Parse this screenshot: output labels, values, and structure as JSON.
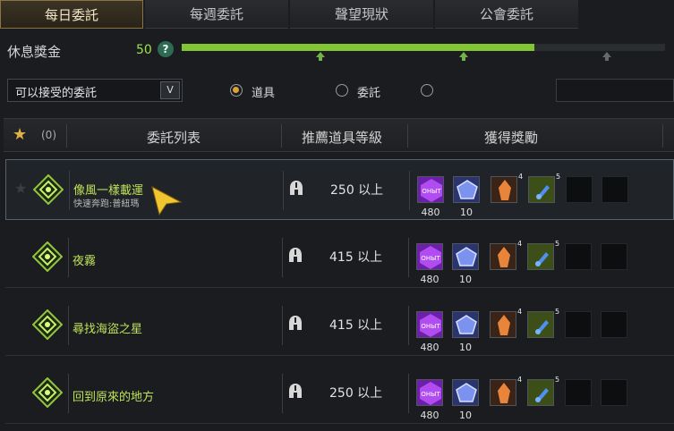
{
  "tabs": [
    {
      "label": "每日委託",
      "active": true
    },
    {
      "label": "每週委託",
      "active": false
    },
    {
      "label": "聲望現狀",
      "active": false
    },
    {
      "label": "公會委託",
      "active": false
    }
  ],
  "rest_bonus": {
    "label": "休息獎金",
    "value": "50",
    "help": "?",
    "fill_fraction": 0.73
  },
  "filter": {
    "select_value": "可以接受的委託",
    "select_arrow": "V",
    "radio_options": [
      {
        "label": "道具",
        "checked": true
      },
      {
        "label": "委託",
        "checked": false
      },
      {
        "label": "",
        "checked": false
      }
    ]
  },
  "table_header": {
    "favorite_count": "(0)",
    "col_list": "委託列表",
    "col_level": "推薦道具等級",
    "col_rewards": "獲得獎勵"
  },
  "rewards": [
    {
      "qty": "480",
      "icon": "purple-crystal-icon",
      "color": "#8b2fc9",
      "text": "ОНЫТ"
    },
    {
      "qty": "10",
      "icon": "blue-gem-icon",
      "color": "#4a63c6"
    },
    {
      "qty": "",
      "icon": "amber-crystal-icon",
      "color": "#c8742b",
      "sup": "4"
    },
    {
      "qty": "",
      "icon": "blue-potion-icon",
      "color": "#5f7a1f",
      "sup": "5"
    }
  ],
  "quests": [
    {
      "name": "像風一樣載運",
      "sub": "快速奔跑:普紐瑪",
      "level": "250 以上",
      "selected": true
    },
    {
      "name": "夜霧",
      "sub": "",
      "level": "415 以上",
      "selected": false
    },
    {
      "name": "尋找海盜之星",
      "sub": "",
      "level": "415 以上",
      "selected": false
    },
    {
      "name": "回到原來的地方",
      "sub": "",
      "level": "250 以上",
      "selected": false
    }
  ],
  "colors": {
    "accent_green": "#82c733",
    "quest_name": "#bfe25a",
    "tab_active_border": "#8a7540"
  }
}
